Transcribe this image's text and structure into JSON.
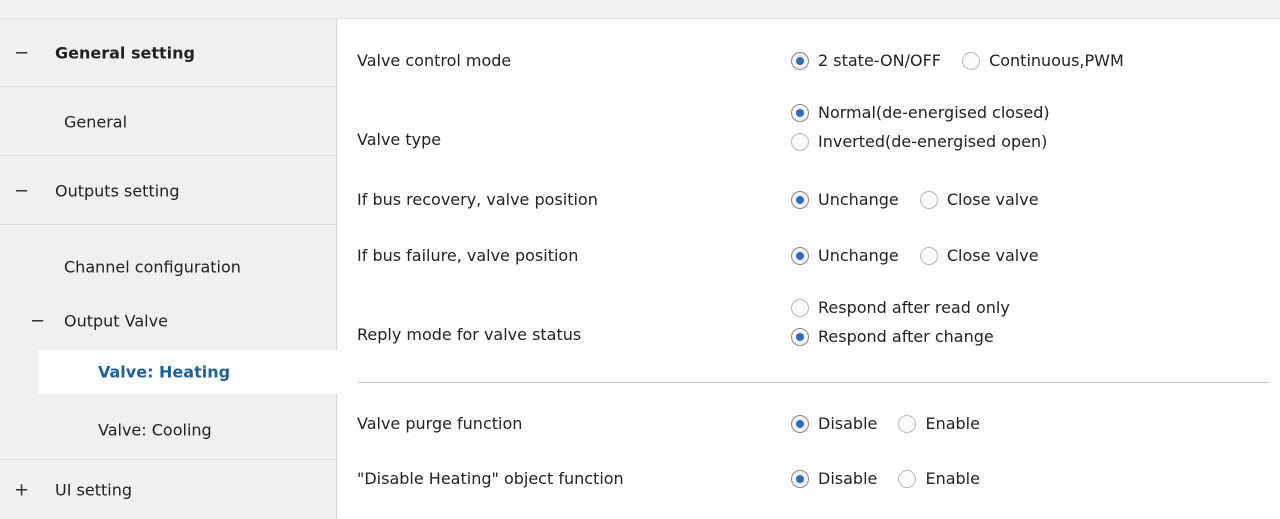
{
  "sidebar": {
    "items": [
      {
        "label": "General setting",
        "icon": "−"
      },
      {
        "label": "General"
      },
      {
        "label": "Outputs setting",
        "icon": "−"
      },
      {
        "label": "Channel configuration"
      },
      {
        "label": "Output Valve",
        "icon": "−"
      },
      {
        "label": "Valve: Heating"
      },
      {
        "label": "Valve: Cooling"
      },
      {
        "label": "UI setting",
        "icon": "+"
      }
    ]
  },
  "params": [
    {
      "label": "Valve control mode",
      "options": [
        "2 state-ON/OFF",
        "Continuous,PWM"
      ],
      "selected": 0
    },
    {
      "label": "Valve type",
      "options": [
        "Normal(de-energised closed)",
        "Inverted(de-energised open)"
      ],
      "selected": 0
    },
    {
      "label": "If bus recovery, valve position",
      "options": [
        "Unchange",
        "Close valve"
      ],
      "selected": 0
    },
    {
      "label": "If bus failure, valve position",
      "options": [
        "Unchange",
        "Close valve"
      ],
      "selected": 0
    },
    {
      "label": "Reply mode for valve status",
      "options": [
        "Respond after read only",
        "Respond after change"
      ],
      "selected": 1
    },
    {
      "label": "Valve purge function",
      "options": [
        "Disable",
        "Enable"
      ],
      "selected": 0
    },
    {
      "label": "\"Disable Heating\" object function",
      "options": [
        "Disable",
        "Enable"
      ],
      "selected": 0
    }
  ],
  "colors": {
    "selected_text": "#1f5f9c",
    "radio_dot": "#2f6fb1"
  }
}
